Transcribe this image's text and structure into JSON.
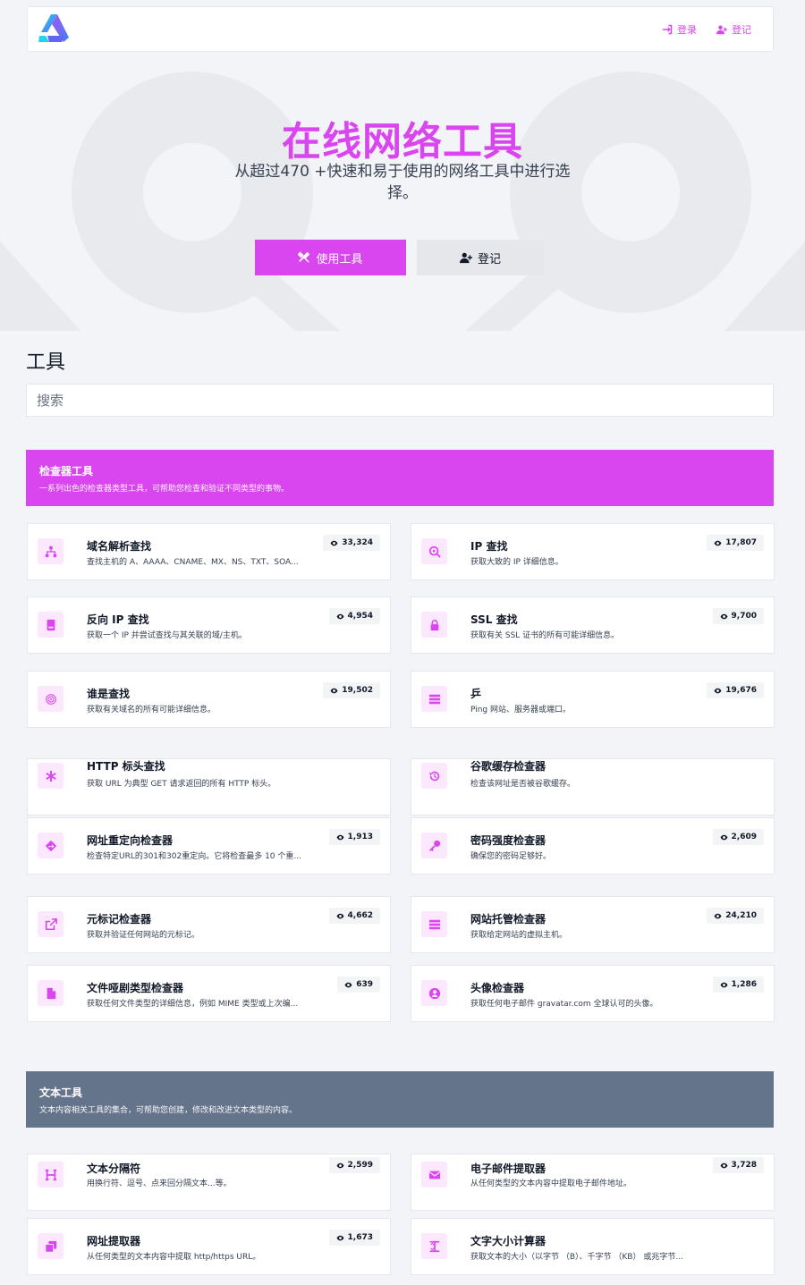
{
  "nav": {
    "login_label": "登录",
    "register_label": "登记"
  },
  "hero": {
    "title": "在线网络工具",
    "subtitle": "从超过470 +快速和易于使用的网络工具中进行选择。",
    "use_tools_label": "使用工具",
    "register_label": "登记"
  },
  "tools": {
    "heading": "工具",
    "search_placeholder": "搜索"
  },
  "categories": [
    {
      "title": "检查器工具",
      "desc": "一系列出色的检查器类型工具，可帮助您检查和验证不同类型的事物。",
      "color": "#d946ef"
    },
    {
      "title": "文本工具",
      "desc": "文本内容相关工具的集合，可帮助您创建，修改和改进文本类型的内容。",
      "color": "#64748b"
    }
  ],
  "checker_tools": [
    {
      "name": "域名解析查找",
      "desc": "查找主机的 A、AAAA、CNAME、MX、NS、TXT、SOA...",
      "views": "33,324",
      "icon": "sitemap-icon"
    },
    {
      "name": "IP 查找",
      "desc": "获取大致的 IP 详细信息。",
      "views": "17,807",
      "icon": "search-location-icon"
    },
    {
      "name": "反向 IP 查找",
      "desc": "获取一个 IP 并尝试查找与其关联的域/主机。",
      "views": "4,954",
      "icon": "book-icon"
    },
    {
      "name": "SSL 查找",
      "desc": "获取有关 SSL 证书的所有可能详细信息。",
      "views": "9,700",
      "icon": "lock-icon"
    },
    {
      "name": "谁是查找",
      "desc": "获取有关域名的所有可能详细信息。",
      "views": "19,502",
      "icon": "fingerprint-icon"
    },
    {
      "name": "乒",
      "desc": "Ping 网站、服务器或端口。",
      "views": "19,676",
      "icon": "server-icon"
    },
    {
      "name": "HTTP 标头查找",
      "desc": "获取 URL 为典型 GET 请求返回的所有 HTTP 标头。",
      "views": "",
      "icon": "asterisk-icon"
    },
    {
      "name": "谷歌缓存检查器",
      "desc": "检查该网址是否被谷歌缓存。",
      "views": "",
      "icon": "history-icon"
    },
    {
      "name": "网址重定向检查器",
      "desc": "检查特定URL的301和302重定向。它将检查最多 10 个重...",
      "views": "1,913",
      "icon": "directions-icon"
    },
    {
      "name": "密码强度检查器",
      "desc": "确保您的密码足够好。",
      "views": "2,609",
      "icon": "key-icon"
    },
    {
      "name": "元标记检查器",
      "desc": "获取并验证任何网站的元标记。",
      "views": "4,662",
      "icon": "external-link-icon"
    },
    {
      "name": "网站托管检查器",
      "desc": "获取给定网站的虚拟主机。",
      "views": "24,210",
      "icon": "server-icon"
    },
    {
      "name": "文件哑剧类型检查器",
      "desc": "获取任何文件类型的详细信息，例如 MIME 类型或上次编...",
      "views": "639",
      "icon": "file-icon"
    },
    {
      "name": "头像检查器",
      "desc": "获取任何电子邮件 gravatar.com 全球认可的头像。",
      "views": "1,286",
      "icon": "user-circle-icon"
    }
  ],
  "text_tools": [
    {
      "name": "文本分隔符",
      "desc": "用换行符、逗号、点来回分隔文本...等。",
      "views": "2,599",
      "icon": "heading-icon"
    },
    {
      "name": "电子邮件提取器",
      "desc": "从任何类型的文本内容中提取电子邮件地址。",
      "views": "3,728",
      "icon": "envelope-icon"
    },
    {
      "name": "网址提取器",
      "desc": "从任何类型的文本内容中提取 http/https URL。",
      "views": "1,673",
      "icon": "copy-icon"
    },
    {
      "name": "文字大小计算器",
      "desc": "获取文本的大小（以字节 （B）、千字节 （KB） 或兆字节...",
      "views": "",
      "icon": "text-height-icon"
    }
  ]
}
